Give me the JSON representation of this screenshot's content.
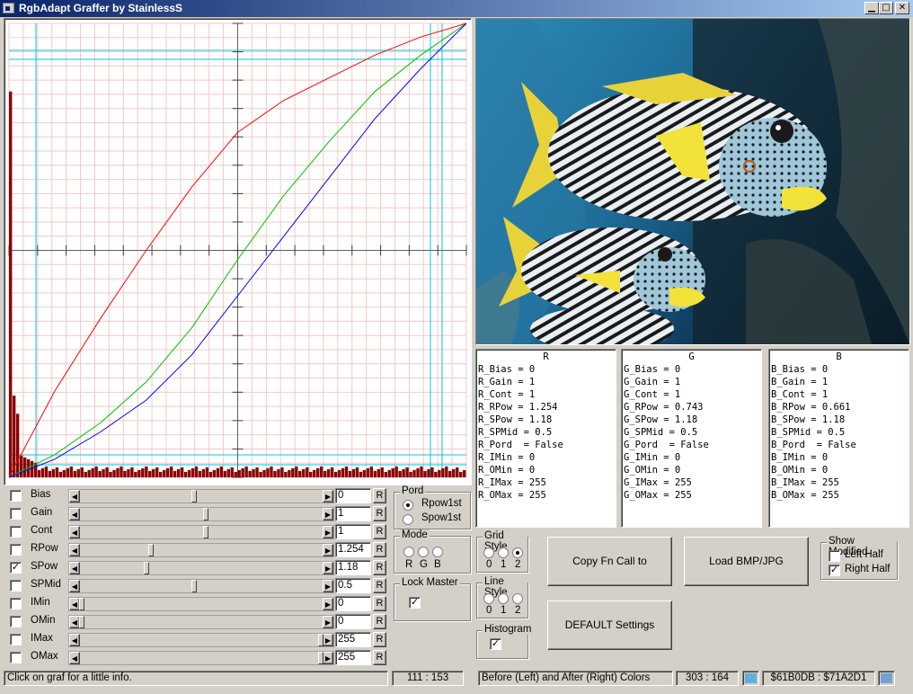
{
  "window": {
    "title": "RgbAdapt Graffer by StainlessS",
    "min": "0",
    "max": "1",
    "close": "r"
  },
  "params": [
    {
      "label": "Bias",
      "value": "0",
      "checked": false,
      "pos": 0.47
    },
    {
      "label": "Gain",
      "value": "1",
      "checked": false,
      "pos": 0.52
    },
    {
      "label": "Cont",
      "value": "1",
      "checked": false,
      "pos": 0.52
    },
    {
      "label": "RPow",
      "value": "1.254",
      "checked": false,
      "pos": 0.29
    },
    {
      "label": "SPow",
      "value": "1.18",
      "checked": true,
      "pos": 0.27
    },
    {
      "label": "SPMid",
      "value": "0.5",
      "checked": false,
      "pos": 0.47
    },
    {
      "label": "IMin",
      "value": "0",
      "checked": false,
      "pos": 0.0
    },
    {
      "label": "OMin",
      "value": "0",
      "checked": false,
      "pos": 0.0
    },
    {
      "label": "IMax",
      "value": "255",
      "checked": false,
      "pos": 1.0
    },
    {
      "label": "OMax",
      "value": "255",
      "checked": false,
      "pos": 1.0
    }
  ],
  "reset_label": "R",
  "pord": {
    "title": "Pord",
    "options": [
      "Rpow1st",
      "Spow1st"
    ],
    "selected": 0
  },
  "mode": {
    "title": "Mode",
    "letters": [
      "R",
      "G",
      "B"
    ]
  },
  "lock_master": {
    "title": "Lock Master",
    "checked": true
  },
  "grid_style": {
    "title": "Grid Style",
    "options": [
      "0",
      "1",
      "2"
    ],
    "selected": 2
  },
  "line_style": {
    "title": "Line Style",
    "options": [
      "0",
      "1",
      "2"
    ]
  },
  "histogram": {
    "title": "Histogram",
    "checked": true
  },
  "buttons": {
    "copy": "Copy Fn Call to ClipBoard",
    "load": "Load BMP/JPG",
    "default": "DEFAULT Settings"
  },
  "show_modified": {
    "title": "Show Modified",
    "left": "Left Half",
    "right": "Right Half",
    "left_checked": false,
    "right_checked": true
  },
  "panels": [
    {
      "header": "R",
      "lines": [
        "R_Bias = 0",
        "R_Gain = 1",
        "R_Cont = 1",
        "R_RPow = 1.254",
        "R_SPow = 1.18",
        "R_SPMid = 0.5",
        "R_Pord  = False",
        "R_IMin = 0",
        "R_OMin = 0",
        "R_IMax = 255",
        "R_OMax = 255"
      ]
    },
    {
      "header": "G",
      "lines": [
        "G_Bias = 0",
        "G_Gain = 1",
        "G_Cont = 1",
        "G_RPow = 0.743",
        "G_SPow = 1.18",
        "G_SPMid = 0.5",
        "G_Pord  = False",
        "G_IMin = 0",
        "G_OMin = 0",
        "G_IMax = 255",
        "G_OMax = 255"
      ]
    },
    {
      "header": "B",
      "lines": [
        "B_Bias = 0",
        "B_Gain = 1",
        "B_Cont = 1",
        "B_RPow = 0.661",
        "B_SPow = 1.18",
        "B_SPMid = 0.5",
        "B_Pord  = False",
        "B_IMin = 0",
        "B_OMin = 0",
        "B_IMax = 255",
        "B_OMax = 255"
      ]
    }
  ],
  "status": {
    "info": "Click on graf for a little info.",
    "coords": "111 : 153",
    "compare": "Before (Left) and After (Right) Colors",
    "pixel": "303 : 164",
    "colors": "$61B0DB : $71A2D1",
    "swatch_before": "#61B0DB",
    "swatch_after": "#71A2D1"
  },
  "curves": {
    "red": {
      "color": "#ff0000",
      "points": [
        [
          0,
          0
        ],
        [
          0.1,
          0.19
        ],
        [
          0.2,
          0.35
        ],
        [
          0.3,
          0.5
        ],
        [
          0.4,
          0.64
        ],
        [
          0.5,
          0.76
        ],
        [
          0.6,
          0.83
        ],
        [
          0.7,
          0.88
        ],
        [
          0.8,
          0.93
        ],
        [
          0.9,
          0.97
        ],
        [
          1,
          1
        ]
      ]
    },
    "green": {
      "color": "#00c000",
      "points": [
        [
          0,
          0
        ],
        [
          0.1,
          0.05
        ],
        [
          0.2,
          0.12
        ],
        [
          0.3,
          0.21
        ],
        [
          0.4,
          0.33
        ],
        [
          0.5,
          0.48
        ],
        [
          0.6,
          0.62
        ],
        [
          0.7,
          0.74
        ],
        [
          0.8,
          0.85
        ],
        [
          0.9,
          0.93
        ],
        [
          1,
          1
        ]
      ]
    },
    "blue": {
      "color": "#0000ff",
      "points": [
        [
          0,
          0
        ],
        [
          0.1,
          0.04
        ],
        [
          0.2,
          0.1
        ],
        [
          0.3,
          0.17
        ],
        [
          0.4,
          0.27
        ],
        [
          0.5,
          0.4
        ],
        [
          0.6,
          0.53
        ],
        [
          0.7,
          0.66
        ],
        [
          0.8,
          0.79
        ],
        [
          0.9,
          0.9
        ],
        [
          1,
          1
        ]
      ]
    }
  }
}
